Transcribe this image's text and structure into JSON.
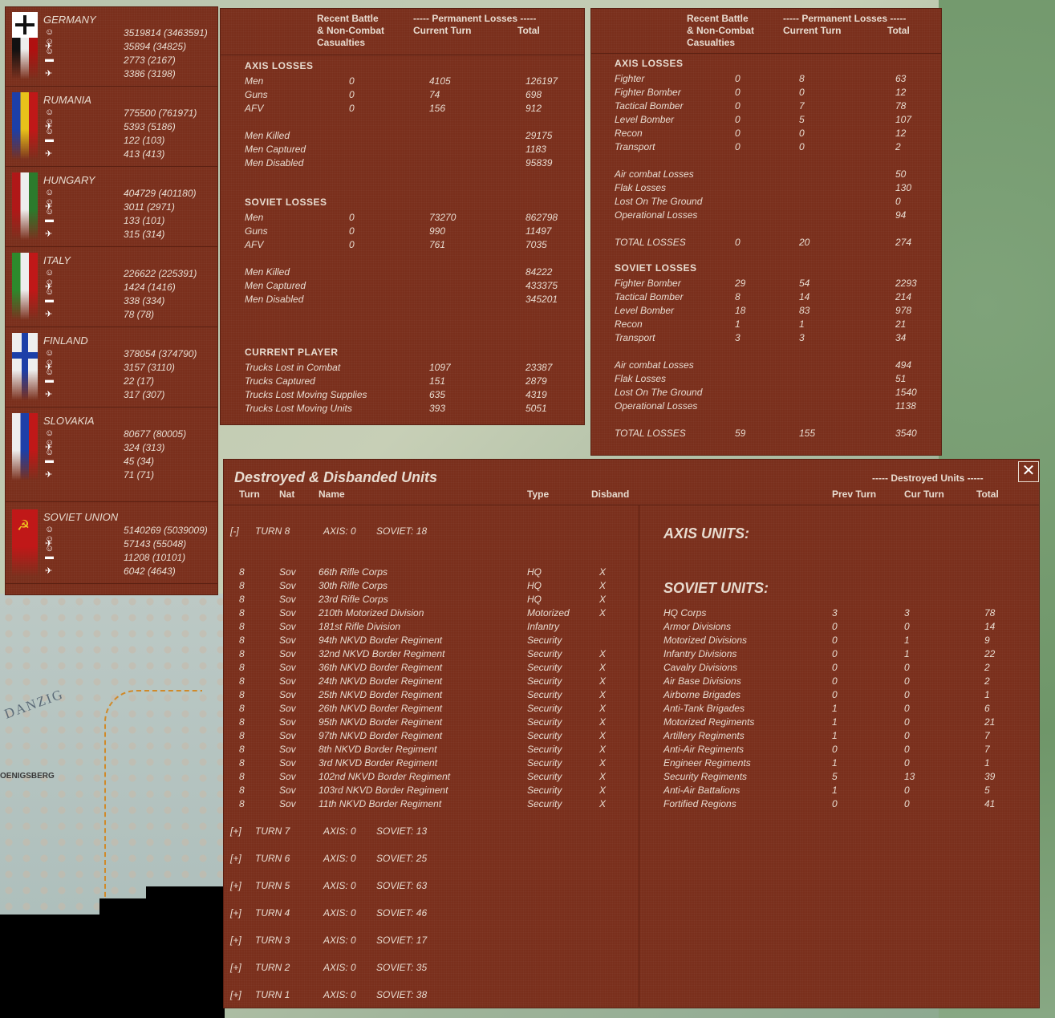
{
  "map": {
    "label_danzig": "DANZIG",
    "label_koenigsberg": "OENIGSBERG"
  },
  "nations": [
    {
      "name": "GERMANY",
      "rows": [
        "3519814 (3463591)",
        "35894 (34825)",
        "2773 (2167)",
        "3386 (3198)"
      ]
    },
    {
      "name": "RUMANIA",
      "rows": [
        "775500 (761971)",
        "5393 (5186)",
        "122 (103)",
        "413 (413)"
      ]
    },
    {
      "name": "HUNGARY",
      "rows": [
        "404729 (401180)",
        "3011 (2971)",
        "133 (101)",
        "315 (314)"
      ]
    },
    {
      "name": "ITALY",
      "rows": [
        "226622 (225391)",
        "1424 (1416)",
        "338 (334)",
        "78 (78)"
      ]
    },
    {
      "name": "FINLAND",
      "rows": [
        "378054 (374790)",
        "3157 (3110)",
        "22 (17)",
        "317 (307)"
      ]
    },
    {
      "name": "SLOVAKIA",
      "rows": [
        "80677 (80005)",
        "324 (313)",
        "45 (34)",
        "71 (71)"
      ]
    },
    {
      "name": "SOVIET UNION",
      "rows": [
        "5140269 (5039009)",
        "57143 (55048)",
        "11208 (10101)",
        "6042 (4643)"
      ]
    }
  ],
  "ground": {
    "hdr_recent": [
      "Recent Battle",
      "& Non-Combat",
      "Casualties"
    ],
    "hdr_perm": "----- Permanent Losses -----",
    "hdr_cur": "Current Turn",
    "hdr_total": "Total",
    "axis_title": "AXIS LOSSES",
    "axis": [
      [
        "Men",
        "0",
        "4105",
        "126197"
      ],
      [
        "Guns",
        "0",
        "74",
        "698"
      ],
      [
        "AFV",
        "0",
        "156",
        "912"
      ]
    ],
    "axis2": [
      [
        "Men Killed",
        "29175"
      ],
      [
        "Men Captured",
        "1183"
      ],
      [
        "Men Disabled",
        "95839"
      ]
    ],
    "soviet_title": "SOVIET LOSSES",
    "soviet": [
      [
        "Men",
        "0",
        "73270",
        "862798"
      ],
      [
        "Guns",
        "0",
        "990",
        "11497"
      ],
      [
        "AFV",
        "0",
        "761",
        "7035"
      ]
    ],
    "soviet2": [
      [
        "Men Killed",
        "84222"
      ],
      [
        "Men Captured",
        "433375"
      ],
      [
        "Men Disabled",
        "345201"
      ]
    ],
    "player_title": "CURRENT PLAYER",
    "player": [
      [
        "Trucks Lost in Combat",
        "1097",
        "23387"
      ],
      [
        "Trucks Captured",
        "151",
        "2879"
      ],
      [
        "Trucks Lost Moving Supplies",
        "635",
        "4319"
      ],
      [
        "Trucks Lost Moving Units",
        "393",
        "5051"
      ]
    ]
  },
  "air": {
    "hdr_recent": [
      "Recent Battle",
      "& Non-Combat",
      "Casualties"
    ],
    "hdr_perm": "----- Permanent Losses -----",
    "hdr_cur": "Current Turn",
    "hdr_total": "Total",
    "axis_title": "AXIS LOSSES",
    "axis": [
      [
        "Fighter",
        "0",
        "8",
        "63"
      ],
      [
        "Fighter Bomber",
        "0",
        "0",
        "12"
      ],
      [
        "Tactical Bomber",
        "0",
        "7",
        "78"
      ],
      [
        "Level Bomber",
        "0",
        "5",
        "107"
      ],
      [
        "Recon",
        "0",
        "0",
        "12"
      ],
      [
        "Transport",
        "0",
        "0",
        "2"
      ]
    ],
    "axis2": [
      [
        "Air combat Losses",
        "50"
      ],
      [
        "Flak Losses",
        "130"
      ],
      [
        "Lost On The Ground",
        "0"
      ],
      [
        "Operational Losses",
        "94"
      ]
    ],
    "axis_total": [
      "TOTAL LOSSES",
      "0",
      "20",
      "274"
    ],
    "soviet_title": "SOVIET LOSSES",
    "soviet": [
      [
        "Fighter Bomber",
        "29",
        "54",
        "2293"
      ],
      [
        "Tactical Bomber",
        "8",
        "14",
        "214"
      ],
      [
        "Level Bomber",
        "18",
        "83",
        "978"
      ],
      [
        "Recon",
        "1",
        "1",
        "21"
      ],
      [
        "Transport",
        "3",
        "3",
        "34"
      ]
    ],
    "soviet2": [
      [
        "Air combat Losses",
        "494"
      ],
      [
        "Flak Losses",
        "51"
      ],
      [
        "Lost On The Ground",
        "1540"
      ],
      [
        "Operational Losses",
        "1138"
      ]
    ],
    "soviet_total": [
      "TOTAL LOSSES",
      "59",
      "155",
      "3540"
    ]
  },
  "units": {
    "title": "Destroyed & Disbanded Units",
    "close": "✕",
    "cols": [
      "Turn",
      "Nat",
      "Name",
      "Type",
      "Disband"
    ],
    "rcols": [
      "----- Destroyed Units -----",
      "Prev Turn",
      "Cur Turn",
      "Total"
    ],
    "open_turn": [
      "[-]",
      "TURN 8",
      "AXIS: 0",
      "SOVIET: 18"
    ],
    "rows": [
      [
        "8",
        "Sov",
        "66th Rifle Corps",
        "HQ",
        "X"
      ],
      [
        "8",
        "Sov",
        "30th Rifle Corps",
        "HQ",
        "X"
      ],
      [
        "8",
        "Sov",
        "23rd Rifle Corps",
        "HQ",
        "X"
      ],
      [
        "8",
        "Sov",
        "210th Motorized Division",
        "Motorized",
        "X"
      ],
      [
        "8",
        "Sov",
        "181st Rifle Division",
        "Infantry",
        ""
      ],
      [
        "8",
        "Sov",
        "94th NKVD Border Regiment",
        "Security",
        ""
      ],
      [
        "8",
        "Sov",
        "32nd NKVD Border Regiment",
        "Security",
        "X"
      ],
      [
        "8",
        "Sov",
        "36th NKVD Border Regiment",
        "Security",
        "X"
      ],
      [
        "8",
        "Sov",
        "24th NKVD Border Regiment",
        "Security",
        "X"
      ],
      [
        "8",
        "Sov",
        "25th NKVD Border Regiment",
        "Security",
        "X"
      ],
      [
        "8",
        "Sov",
        "26th NKVD Border Regiment",
        "Security",
        "X"
      ],
      [
        "8",
        "Sov",
        "95th NKVD Border Regiment",
        "Security",
        "X"
      ],
      [
        "8",
        "Sov",
        "97th NKVD Border Regiment",
        "Security",
        "X"
      ],
      [
        "8",
        "Sov",
        "8th NKVD Border Regiment",
        "Security",
        "X"
      ],
      [
        "8",
        "Sov",
        "3rd NKVD Border Regiment",
        "Security",
        "X"
      ],
      [
        "8",
        "Sov",
        "102nd NKVD Border Regiment",
        "Security",
        "X"
      ],
      [
        "8",
        "Sov",
        "103rd NKVD Border Regiment",
        "Security",
        "X"
      ],
      [
        "8",
        "Sov",
        "11th NKVD Border Regiment",
        "Security",
        "X"
      ]
    ],
    "closed_turns": [
      [
        "[+]",
        "TURN 7",
        "AXIS: 0",
        "SOVIET: 13"
      ],
      [
        "[+]",
        "TURN 6",
        "AXIS: 0",
        "SOVIET: 25"
      ],
      [
        "[+]",
        "TURN 5",
        "AXIS: 0",
        "SOVIET: 63"
      ],
      [
        "[+]",
        "TURN 4",
        "AXIS: 0",
        "SOVIET: 46"
      ],
      [
        "[+]",
        "TURN 3",
        "AXIS: 0",
        "SOVIET: 17"
      ],
      [
        "[+]",
        "TURN 2",
        "AXIS: 0",
        "SOVIET: 35"
      ],
      [
        "[+]",
        "TURN 1",
        "AXIS: 0",
        "SOVIET: 38"
      ]
    ],
    "axis_units": "AXIS UNITS:",
    "soviet_units": "SOVIET UNITS:",
    "summary": [
      [
        "HQ Corps",
        "3",
        "3",
        "78"
      ],
      [
        "Armor Divisions",
        "0",
        "0",
        "14"
      ],
      [
        "Motorized Divisions",
        "0",
        "1",
        "9"
      ],
      [
        "Infantry Divisions",
        "0",
        "1",
        "22"
      ],
      [
        "Cavalry Divisions",
        "0",
        "0",
        "2"
      ],
      [
        "Air Base Divisions",
        "0",
        "0",
        "2"
      ],
      [
        "Airborne Brigades",
        "0",
        "0",
        "1"
      ],
      [
        "Anti-Tank Brigades",
        "1",
        "0",
        "6"
      ],
      [
        "Motorized Regiments",
        "1",
        "0",
        "21"
      ],
      [
        "Artillery Regiments",
        "1",
        "0",
        "7"
      ],
      [
        "Anti-Air Regiments",
        "0",
        "0",
        "7"
      ],
      [
        "Engineer Regiments",
        "1",
        "0",
        "1"
      ],
      [
        "Security Regiments",
        "5",
        "13",
        "39"
      ],
      [
        "Anti-Air Battalions",
        "1",
        "0",
        "5"
      ],
      [
        "Fortified Regions",
        "0",
        "0",
        "41"
      ]
    ]
  }
}
